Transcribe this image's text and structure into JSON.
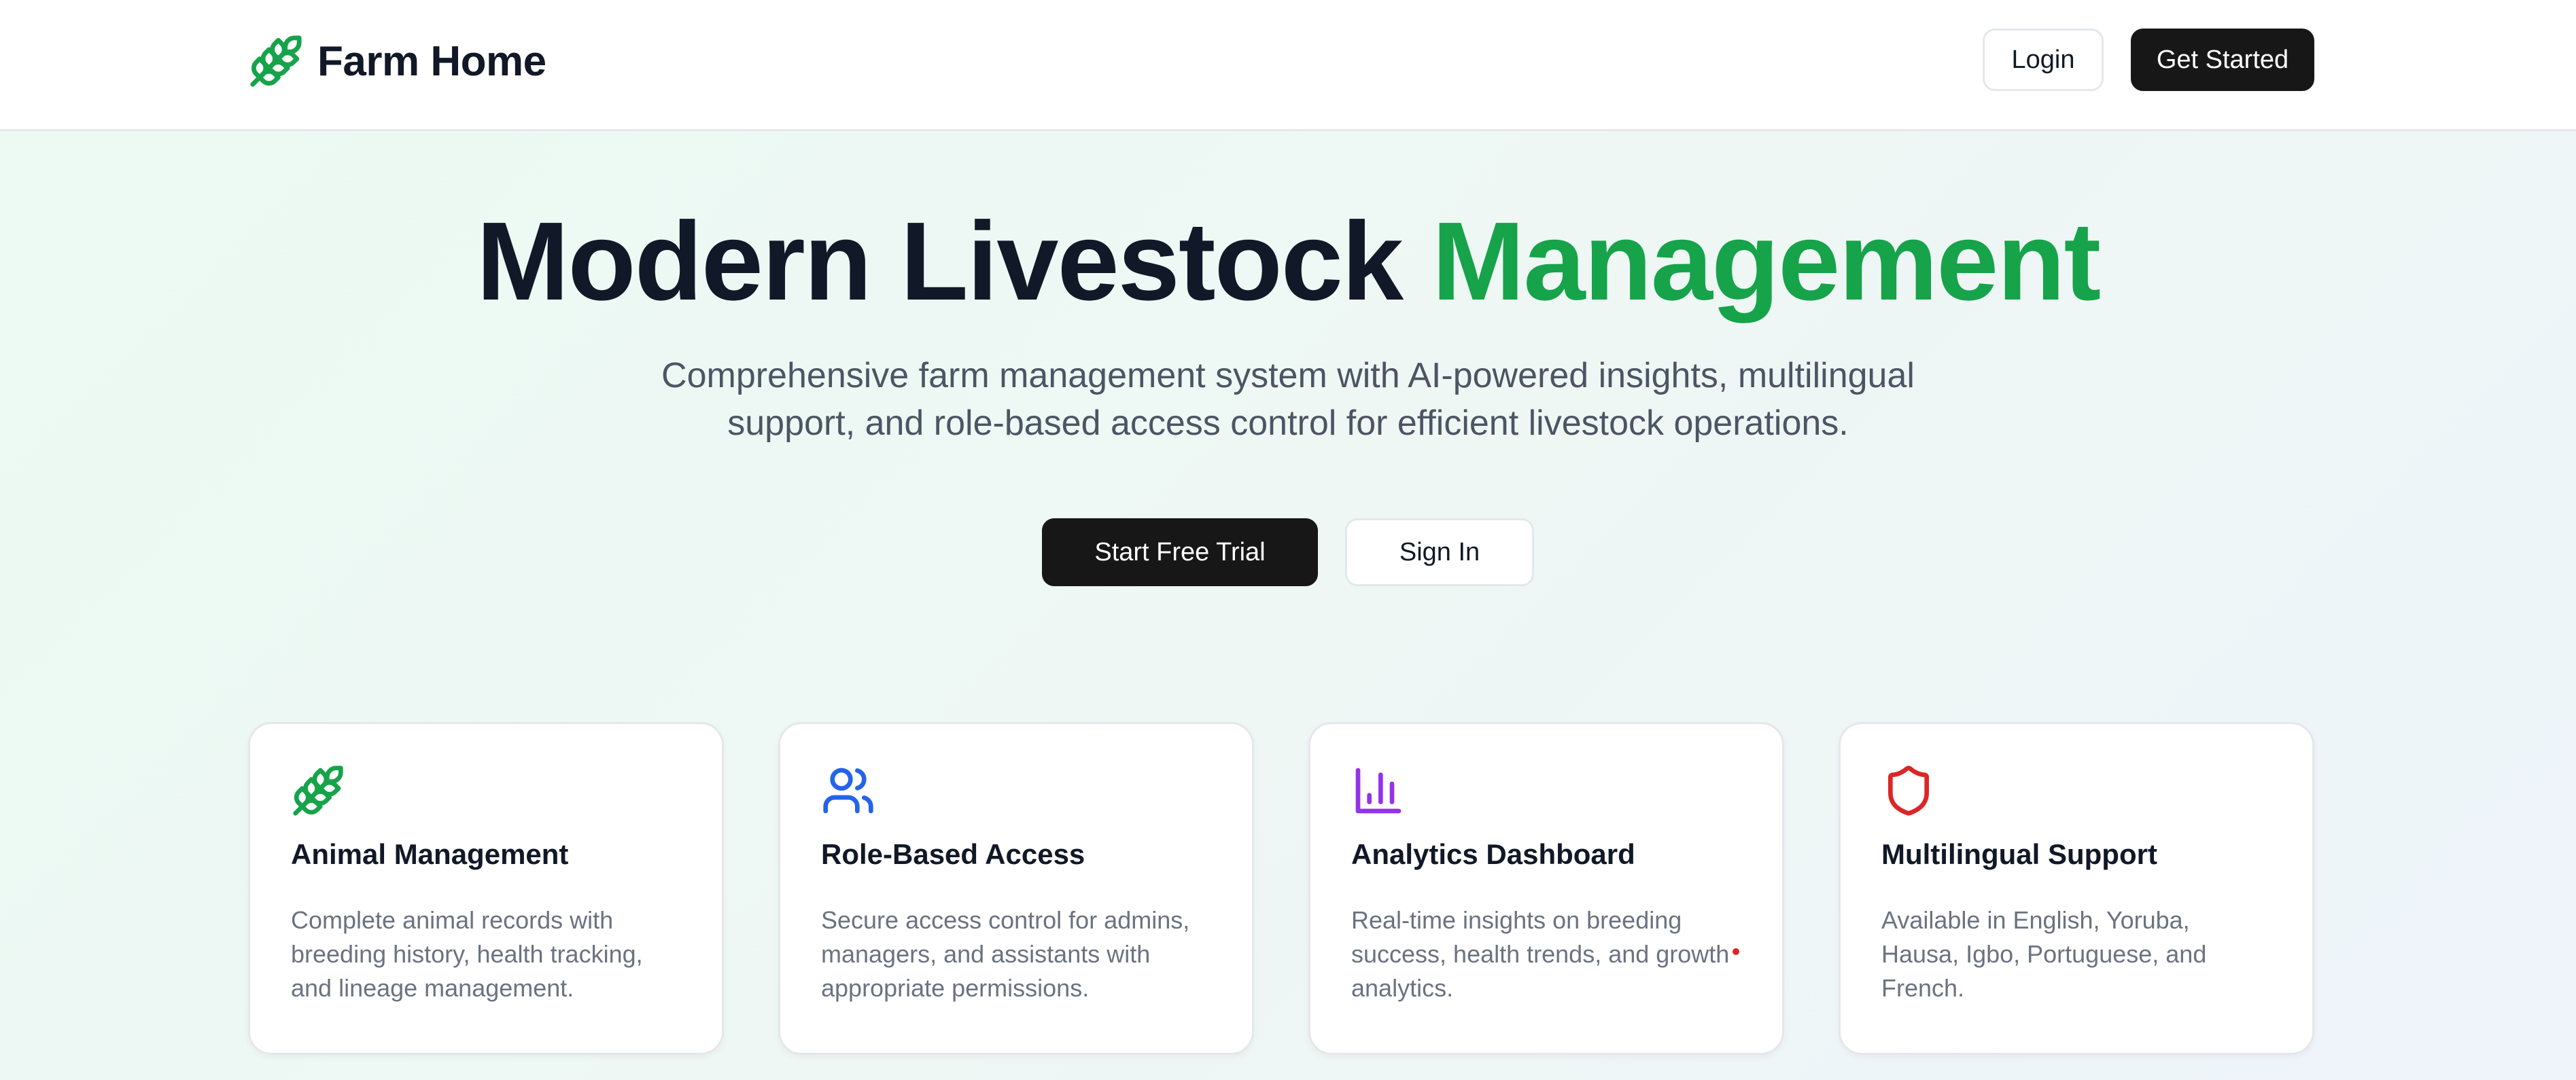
{
  "header": {
    "brand": "Farm Home",
    "login": "Login",
    "get_started": "Get Started"
  },
  "hero": {
    "title_main": "Modern Livestock",
    "title_accent": "Management",
    "subtitle": "Comprehensive farm management system with AI-powered insights, multilingual support, and role-based access control for efficient livestock operations.",
    "primary_cta": "Start Free Trial",
    "secondary_cta": "Sign In"
  },
  "features": [
    {
      "icon": "wheat-icon",
      "title": "Animal Management",
      "description": "Complete animal records with breeding history, health tracking, and lineage management.",
      "color": "#16a34a"
    },
    {
      "icon": "users-icon",
      "title": "Role-Based Access",
      "description": "Secure access control for admins, managers, and assistants with appropriate permissions.",
      "color": "#2563eb"
    },
    {
      "icon": "bar-chart-icon",
      "title": "Analytics Dashboard",
      "description": "Real-time insights on breeding success, health trends, and growth analytics.",
      "color": "#9333ea"
    },
    {
      "icon": "shield-icon",
      "title": "Multilingual Support",
      "description": "Available in English, Yoruba, Hausa, Igbo, Portuguese, and French.",
      "color": "#dc2626"
    }
  ],
  "colors": {
    "accent": "#16a34a",
    "dark_button": "#171717"
  }
}
